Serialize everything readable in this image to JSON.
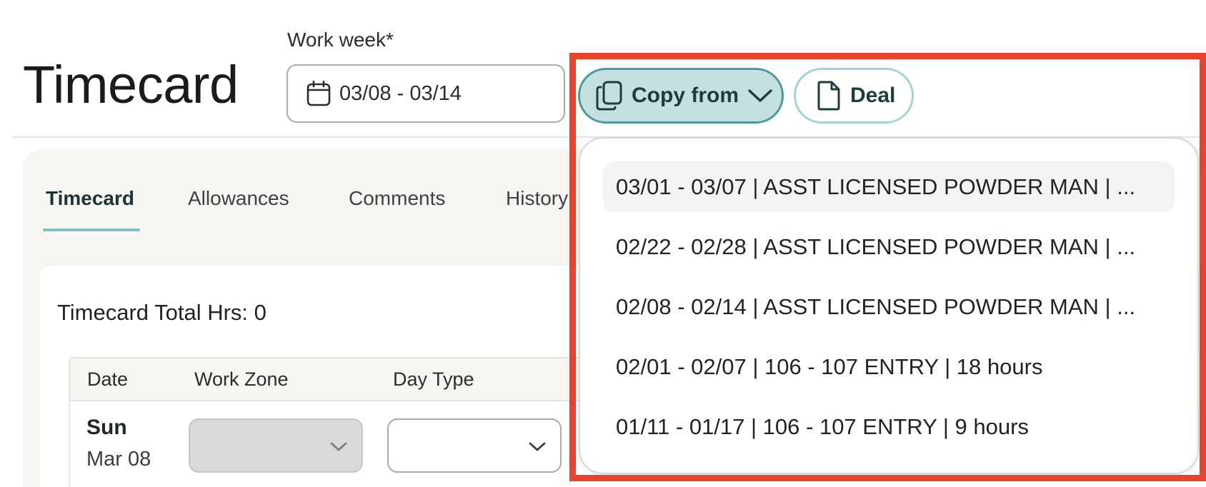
{
  "page": {
    "title": "Timecard"
  },
  "work_week": {
    "label": "Work week*",
    "value": "03/08 - 03/14"
  },
  "toolbar": {
    "copy_label": "Copy from",
    "deal_label": "Deal"
  },
  "tabs": [
    {
      "label": "Timecard",
      "active": true
    },
    {
      "label": "Allowances",
      "active": false
    },
    {
      "label": "Comments",
      "active": false
    },
    {
      "label": "History",
      "active": false
    }
  ],
  "summary": {
    "total_label": "Timecard Total Hrs: 0"
  },
  "table": {
    "headers": [
      "Date",
      "Work Zone",
      "Day Type"
    ],
    "rows": [
      {
        "day": "Sun",
        "date": "Mar 08"
      }
    ]
  },
  "dropdown": {
    "items": [
      "03/01 - 03/07 | ASST LICENSED POWDER MAN | ...",
      "02/22 - 02/28 | ASST LICENSED POWDER MAN | ...",
      "02/08 - 02/14 | ASST LICENSED POWDER MAN | ...",
      "02/01 - 02/07 | 106 - 107 ENTRY | 18 hours",
      "01/11 - 01/17 | 106 - 107 ENTRY | 9 hours"
    ]
  },
  "colors": {
    "accent": "#4c9a9b",
    "accent_fill": "#c5e0e0",
    "highlight": "#e8432d",
    "tab_underline": "#7fc0c1"
  },
  "icons": {
    "work_week": "calendar-icon",
    "copy": "copy-icon",
    "copy_chevron": "chevron-down-icon",
    "deal": "document-icon",
    "select_chevron": "chevron-down-icon"
  }
}
